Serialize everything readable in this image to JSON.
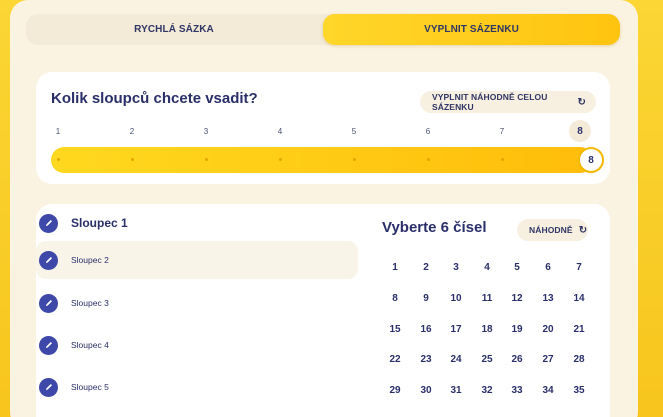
{
  "tabs": [
    {
      "label": "RYCHLÁ SÁZKA",
      "active": false
    },
    {
      "label": "VYPLNIT SÁZENKU",
      "active": true
    }
  ],
  "columns_card": {
    "title": "Kolik sloupců chcete vsadit?",
    "random_all_label": "VYPLNIT NÁHODNĚ CELOU SÁZENKU",
    "scale_ticks": [
      "1",
      "2",
      "3",
      "4",
      "5",
      "6",
      "7"
    ],
    "selected_label": "8",
    "selected_value": 8,
    "max_value": 8
  },
  "column_list": {
    "items": [
      {
        "label": "Sloupec 1",
        "active": true
      },
      {
        "label": "Sloupec 2",
        "active": false
      },
      {
        "label": "Sloupec 3",
        "active": false
      },
      {
        "label": "Sloupec 4",
        "active": false
      },
      {
        "label": "Sloupec 5",
        "active": false
      }
    ]
  },
  "number_picker": {
    "title": "Vyberte 6 čísel",
    "random_label": "NÁHODNĚ",
    "numbers": [
      "1",
      "2",
      "3",
      "4",
      "5",
      "6",
      "7",
      "8",
      "9",
      "10",
      "11",
      "12",
      "13",
      "14",
      "15",
      "16",
      "17",
      "18",
      "19",
      "20",
      "21",
      "22",
      "23",
      "24",
      "25",
      "26",
      "27",
      "28",
      "29",
      "30",
      "31",
      "32",
      "33",
      "34",
      "35"
    ]
  },
  "icons": {
    "refresh": "refresh-icon",
    "pencil": "pencil-icon"
  },
  "colors": {
    "background": "#f7c51d",
    "accent": "#ffc410",
    "text": "#2a2f6a",
    "edit_button": "#3d48a8"
  }
}
